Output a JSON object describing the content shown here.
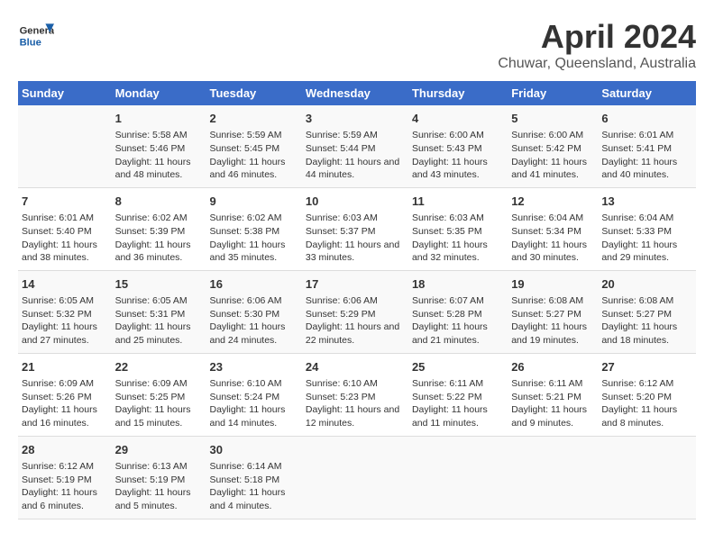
{
  "logo": {
    "line1": "General",
    "line2": "Blue"
  },
  "title": "April 2024",
  "subtitle": "Chuwar, Queensland, Australia",
  "headers": [
    "Sunday",
    "Monday",
    "Tuesday",
    "Wednesday",
    "Thursday",
    "Friday",
    "Saturday"
  ],
  "weeks": [
    [
      {
        "day": "",
        "sunrise": "",
        "sunset": "",
        "daylight": ""
      },
      {
        "day": "1",
        "sunrise": "Sunrise: 5:58 AM",
        "sunset": "Sunset: 5:46 PM",
        "daylight": "Daylight: 11 hours and 48 minutes."
      },
      {
        "day": "2",
        "sunrise": "Sunrise: 5:59 AM",
        "sunset": "Sunset: 5:45 PM",
        "daylight": "Daylight: 11 hours and 46 minutes."
      },
      {
        "day": "3",
        "sunrise": "Sunrise: 5:59 AM",
        "sunset": "Sunset: 5:44 PM",
        "daylight": "Daylight: 11 hours and 44 minutes."
      },
      {
        "day": "4",
        "sunrise": "Sunrise: 6:00 AM",
        "sunset": "Sunset: 5:43 PM",
        "daylight": "Daylight: 11 hours and 43 minutes."
      },
      {
        "day": "5",
        "sunrise": "Sunrise: 6:00 AM",
        "sunset": "Sunset: 5:42 PM",
        "daylight": "Daylight: 11 hours and 41 minutes."
      },
      {
        "day": "6",
        "sunrise": "Sunrise: 6:01 AM",
        "sunset": "Sunset: 5:41 PM",
        "daylight": "Daylight: 11 hours and 40 minutes."
      }
    ],
    [
      {
        "day": "7",
        "sunrise": "Sunrise: 6:01 AM",
        "sunset": "Sunset: 5:40 PM",
        "daylight": "Daylight: 11 hours and 38 minutes."
      },
      {
        "day": "8",
        "sunrise": "Sunrise: 6:02 AM",
        "sunset": "Sunset: 5:39 PM",
        "daylight": "Daylight: 11 hours and 36 minutes."
      },
      {
        "day": "9",
        "sunrise": "Sunrise: 6:02 AM",
        "sunset": "Sunset: 5:38 PM",
        "daylight": "Daylight: 11 hours and 35 minutes."
      },
      {
        "day": "10",
        "sunrise": "Sunrise: 6:03 AM",
        "sunset": "Sunset: 5:37 PM",
        "daylight": "Daylight: 11 hours and 33 minutes."
      },
      {
        "day": "11",
        "sunrise": "Sunrise: 6:03 AM",
        "sunset": "Sunset: 5:35 PM",
        "daylight": "Daylight: 11 hours and 32 minutes."
      },
      {
        "day": "12",
        "sunrise": "Sunrise: 6:04 AM",
        "sunset": "Sunset: 5:34 PM",
        "daylight": "Daylight: 11 hours and 30 minutes."
      },
      {
        "day": "13",
        "sunrise": "Sunrise: 6:04 AM",
        "sunset": "Sunset: 5:33 PM",
        "daylight": "Daylight: 11 hours and 29 minutes."
      }
    ],
    [
      {
        "day": "14",
        "sunrise": "Sunrise: 6:05 AM",
        "sunset": "Sunset: 5:32 PM",
        "daylight": "Daylight: 11 hours and 27 minutes."
      },
      {
        "day": "15",
        "sunrise": "Sunrise: 6:05 AM",
        "sunset": "Sunset: 5:31 PM",
        "daylight": "Daylight: 11 hours and 25 minutes."
      },
      {
        "day": "16",
        "sunrise": "Sunrise: 6:06 AM",
        "sunset": "Sunset: 5:30 PM",
        "daylight": "Daylight: 11 hours and 24 minutes."
      },
      {
        "day": "17",
        "sunrise": "Sunrise: 6:06 AM",
        "sunset": "Sunset: 5:29 PM",
        "daylight": "Daylight: 11 hours and 22 minutes."
      },
      {
        "day": "18",
        "sunrise": "Sunrise: 6:07 AM",
        "sunset": "Sunset: 5:28 PM",
        "daylight": "Daylight: 11 hours and 21 minutes."
      },
      {
        "day": "19",
        "sunrise": "Sunrise: 6:08 AM",
        "sunset": "Sunset: 5:27 PM",
        "daylight": "Daylight: 11 hours and 19 minutes."
      },
      {
        "day": "20",
        "sunrise": "Sunrise: 6:08 AM",
        "sunset": "Sunset: 5:27 PM",
        "daylight": "Daylight: 11 hours and 18 minutes."
      }
    ],
    [
      {
        "day": "21",
        "sunrise": "Sunrise: 6:09 AM",
        "sunset": "Sunset: 5:26 PM",
        "daylight": "Daylight: 11 hours and 16 minutes."
      },
      {
        "day": "22",
        "sunrise": "Sunrise: 6:09 AM",
        "sunset": "Sunset: 5:25 PM",
        "daylight": "Daylight: 11 hours and 15 minutes."
      },
      {
        "day": "23",
        "sunrise": "Sunrise: 6:10 AM",
        "sunset": "Sunset: 5:24 PM",
        "daylight": "Daylight: 11 hours and 14 minutes."
      },
      {
        "day": "24",
        "sunrise": "Sunrise: 6:10 AM",
        "sunset": "Sunset: 5:23 PM",
        "daylight": "Daylight: 11 hours and 12 minutes."
      },
      {
        "day": "25",
        "sunrise": "Sunrise: 6:11 AM",
        "sunset": "Sunset: 5:22 PM",
        "daylight": "Daylight: 11 hours and 11 minutes."
      },
      {
        "day": "26",
        "sunrise": "Sunrise: 6:11 AM",
        "sunset": "Sunset: 5:21 PM",
        "daylight": "Daylight: 11 hours and 9 minutes."
      },
      {
        "day": "27",
        "sunrise": "Sunrise: 6:12 AM",
        "sunset": "Sunset: 5:20 PM",
        "daylight": "Daylight: 11 hours and 8 minutes."
      }
    ],
    [
      {
        "day": "28",
        "sunrise": "Sunrise: 6:12 AM",
        "sunset": "Sunset: 5:19 PM",
        "daylight": "Daylight: 11 hours and 6 minutes."
      },
      {
        "day": "29",
        "sunrise": "Sunrise: 6:13 AM",
        "sunset": "Sunset: 5:19 PM",
        "daylight": "Daylight: 11 hours and 5 minutes."
      },
      {
        "day": "30",
        "sunrise": "Sunrise: 6:14 AM",
        "sunset": "Sunset: 5:18 PM",
        "daylight": "Daylight: 11 hours and 4 minutes."
      },
      {
        "day": "",
        "sunrise": "",
        "sunset": "",
        "daylight": ""
      },
      {
        "day": "",
        "sunrise": "",
        "sunset": "",
        "daylight": ""
      },
      {
        "day": "",
        "sunrise": "",
        "sunset": "",
        "daylight": ""
      },
      {
        "day": "",
        "sunrise": "",
        "sunset": "",
        "daylight": ""
      }
    ]
  ]
}
